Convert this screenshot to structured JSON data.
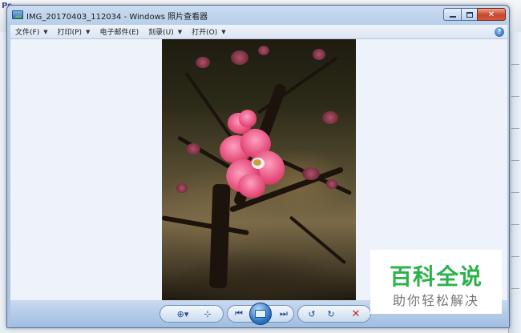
{
  "window": {
    "title": "IMG_20170403_112034 - Windows 照片查看器"
  },
  "menu": {
    "items": [
      {
        "label": "文件(F)"
      },
      {
        "label": "打印(P)"
      },
      {
        "label": "电子邮件(E)"
      },
      {
        "label": "刻录(U)"
      },
      {
        "label": "打开(O)"
      }
    ],
    "help": "?"
  },
  "toolbar": {
    "zoom": "zoom-icon",
    "fit": "actual-size-icon",
    "previous": "previous-icon",
    "slideshow": "slideshow-icon",
    "next": "next-icon",
    "rotate_left": "rotate-counterclockwise-icon",
    "rotate_right": "rotate-clockwise-icon",
    "delete": "delete-icon"
  },
  "background_app": {
    "logo_text": "Ps"
  },
  "watermark": {
    "title": "百科全说",
    "subtitle": "助你轻松解决"
  }
}
